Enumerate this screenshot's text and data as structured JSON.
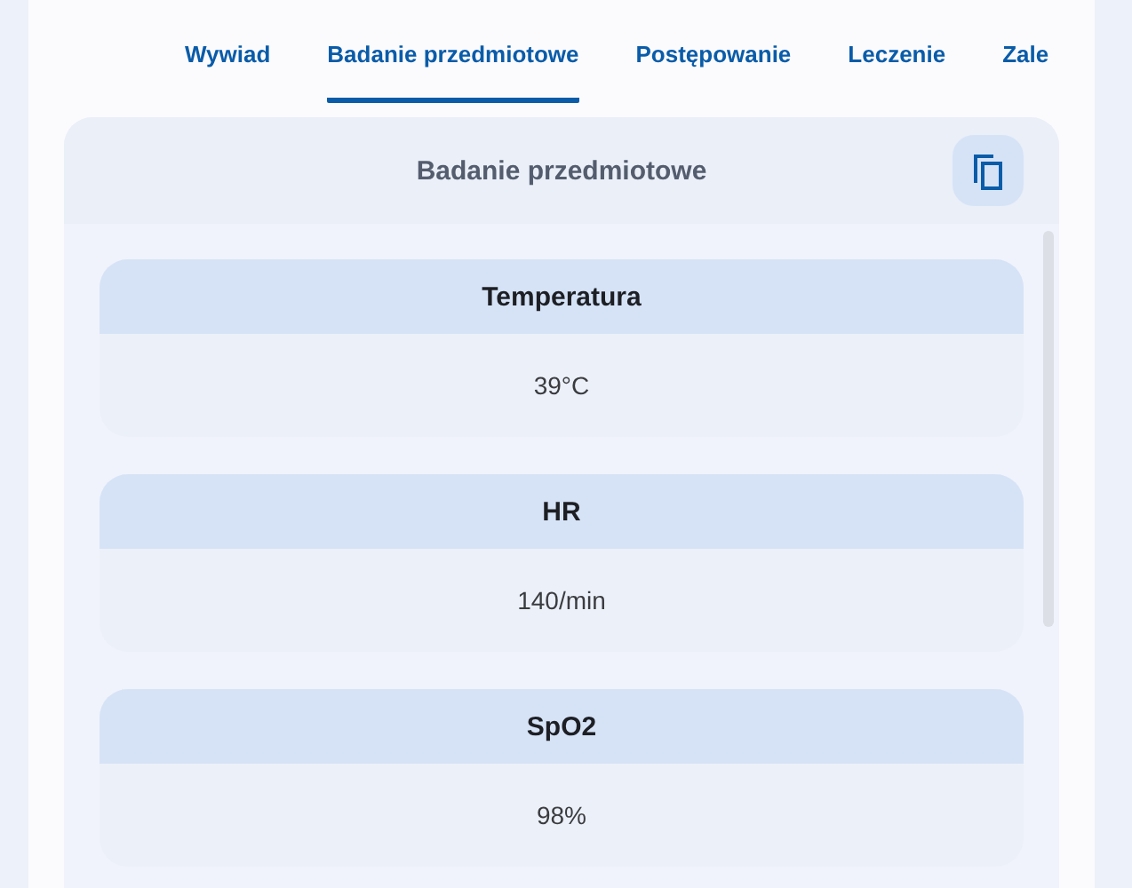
{
  "tabs": [
    {
      "label": "Wywiad",
      "selected": false
    },
    {
      "label": "Badanie przedmiotowe",
      "selected": true
    },
    {
      "label": "Postępowanie",
      "selected": false
    },
    {
      "label": "Leczenie",
      "selected": false
    },
    {
      "label": "Zale",
      "selected": false
    }
  ],
  "section": {
    "title": "Badanie przedmiotowe",
    "items": [
      {
        "label": "Temperatura",
        "value": "39°C"
      },
      {
        "label": "HR",
        "value": "140/min"
      },
      {
        "label": "SpO2",
        "value": "98%"
      }
    ]
  }
}
